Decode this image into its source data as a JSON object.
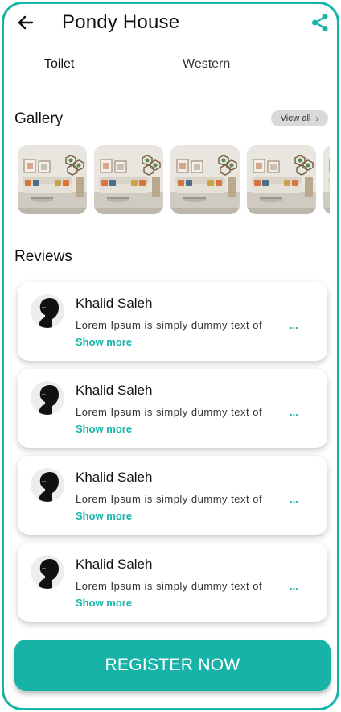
{
  "header": {
    "title": "Pondy House",
    "back_icon": "arrow-left-icon",
    "share_icon": "share-icon"
  },
  "spec": {
    "label": "Toilet",
    "value": "Western"
  },
  "gallery": {
    "title": "Gallery",
    "view_all_label": "View all",
    "image_count_visible": 5
  },
  "reviews": {
    "title": "Reviews",
    "items": [
      {
        "name": "Khalid Saleh",
        "text": "Lorem Ipsum is simply dummy text of",
        "ellipsis": "...",
        "show_more": "Show more"
      },
      {
        "name": "Khalid Saleh",
        "text": "Lorem Ipsum is simply dummy text of",
        "ellipsis": "...",
        "show_more": "Show more"
      },
      {
        "name": "Khalid Saleh",
        "text": "Lorem Ipsum is simply dummy text of",
        "ellipsis": "...",
        "show_more": "Show more"
      },
      {
        "name": "Khalid Saleh",
        "text": "Lorem Ipsum is simply dummy text of",
        "ellipsis": "...",
        "show_more": "Show more"
      }
    ]
  },
  "cta": {
    "register_label": "REGISTER NOW"
  },
  "colors": {
    "accent": "#17b3a8",
    "view_all_bg": "#d9d9d9"
  }
}
